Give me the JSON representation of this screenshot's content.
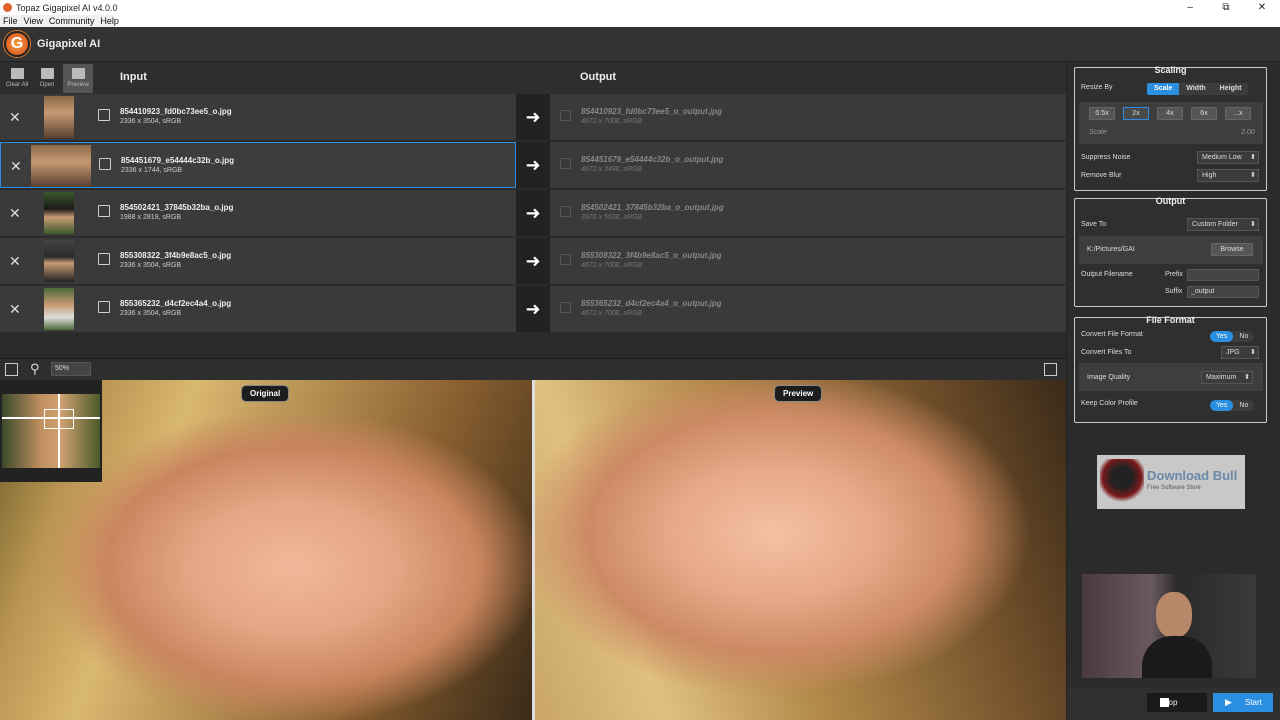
{
  "window": {
    "title": "Topaz Gigapixel AI v4.0.0",
    "min": "–",
    "max": "⧉",
    "close": "✕"
  },
  "menu": [
    "File",
    "View",
    "Community",
    "Help"
  ],
  "app": {
    "name": "Gigapixel AI",
    "logo_letter": "G"
  },
  "toolbar": {
    "clear_all": "Clear All",
    "open": "Open",
    "preview": "Preview"
  },
  "columns": {
    "input": "Input",
    "output": "Output"
  },
  "files": [
    {
      "name": "854410923_fd0bc73ee5_o.jpg",
      "meta": "2336 x 3504, sRGB",
      "out_name": "854410923_fd0bc73ee5_o_output.jpg",
      "out_meta": "4672 x 7008, sRGB"
    },
    {
      "name": "854451679_e54444c32b_o.jpg",
      "meta": "2336 x 1744, sRGB",
      "out_name": "854451679_e54444c32b_o_output.jpg",
      "out_meta": "4672 x 3488, sRGB"
    },
    {
      "name": "854502421_37845b32ba_o.jpg",
      "meta": "1988 x 2819, sRGB",
      "out_name": "854502421_37845b32ba_o_output.jpg",
      "out_meta": "3976 x 5638, sRGB"
    },
    {
      "name": "855308322_3f4b9e8ac5_o.jpg",
      "meta": "2336 x 3504, sRGB",
      "out_name": "855308322_3f4b9e8ac5_o_output.jpg",
      "out_meta": "4672 x 7008, sRGB"
    },
    {
      "name": "855365232_d4cf2ec4a4_o.jpg",
      "meta": "2336 x 3504, sRGB",
      "out_name": "855365232_d4cf2ec4a4_o_output.jpg",
      "out_meta": "4672 x 7008, sRGB"
    }
  ],
  "zoom": "50%",
  "preview": {
    "original_label": "Original",
    "preview_label": "Preview"
  },
  "scaling": {
    "title": "Scaling",
    "resize_by": "Resize By",
    "modes": [
      "Scale",
      "Width",
      "Height"
    ],
    "scales": [
      "0.5x",
      "2x",
      "4x",
      "6x",
      "...x"
    ],
    "scale_label": "Scale",
    "scale_value": "2.00",
    "suppress_noise": "Suppress Noise",
    "suppress_noise_value": "Medium Low",
    "remove_blur": "Remove Blur",
    "remove_blur_value": "High"
  },
  "output": {
    "title": "Output",
    "save_to": "Save To",
    "save_to_value": "Custom Folder",
    "path": "K:/Pictures/GAI",
    "browse": "Browse",
    "output_filename": "Output Filename",
    "prefix": "Prefix",
    "prefix_value": "",
    "suffix": "Suffix",
    "suffix_value": "_output"
  },
  "file_format": {
    "title": "File Format",
    "convert": "Convert File Format",
    "yes": "Yes",
    "no": "No",
    "convert_to": "Convert Files To",
    "convert_to_value": "JPG",
    "image_quality": "Image Quality",
    "image_quality_value": "Maximum",
    "keep_profile": "Keep Color Profile"
  },
  "brand": {
    "name": "Download Bull",
    "tagline": "Free Software Store"
  },
  "actions": {
    "stop": "Stop",
    "start": "Start"
  },
  "colors": {
    "accent": "#2a8fe0",
    "bg": "#2b2b2b"
  }
}
